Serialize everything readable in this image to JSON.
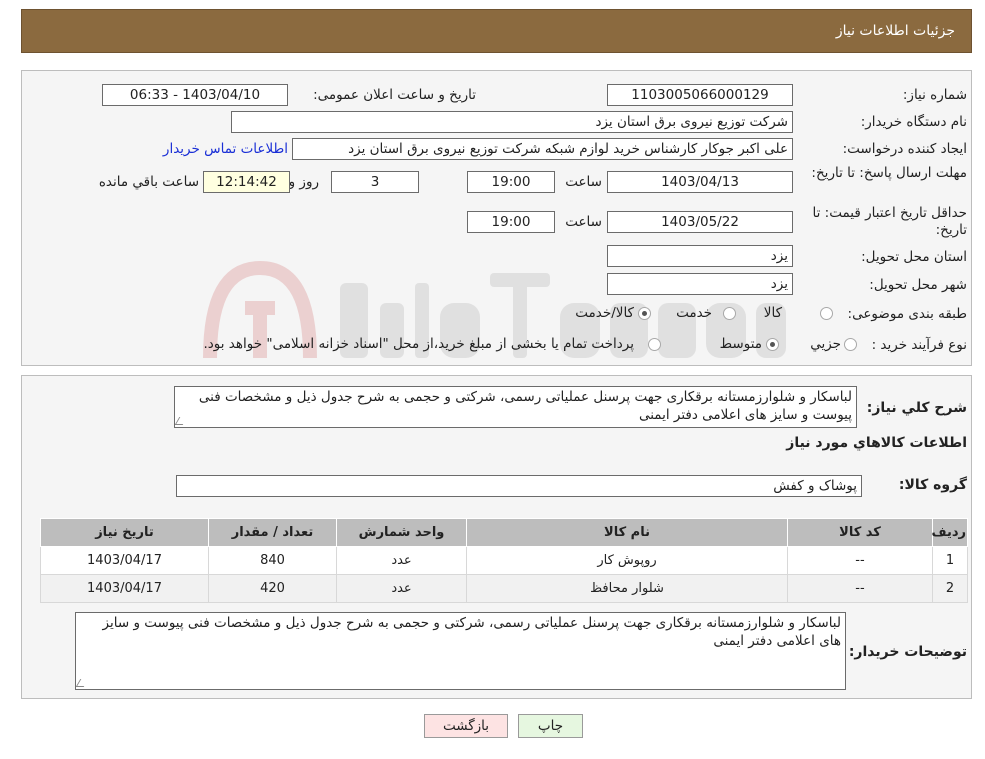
{
  "header": {
    "title": "جزئیات اطلاعات نیاز"
  },
  "form": {
    "need_number_label": "شماره نیاز:",
    "need_number": "1103005066000129",
    "announce_label": "تاریخ و ساعت اعلان عمومی:",
    "announce_value": "1403/04/10 - 06:33",
    "buyer_org_label": "نام دستگاه خریدار:",
    "buyer_org": "شرکت توزیع نیروی برق استان یزد",
    "creator_label": "ایجاد کننده درخواست:",
    "creator": "علی اکبر  جوکار  کارشناس خرید لوازم شبکه  شرکت توزیع نیروی برق استان یزد",
    "contact_link": "اطلاعات تماس خریدار",
    "reply_deadline_label": "مهلت ارسال پاسخ: تا تاریخ:",
    "reply_date": "1403/04/13",
    "time_label": "ساعت",
    "reply_time": "19:00",
    "days_value": "3",
    "days_label": "روز و",
    "remaining_time": "12:14:42",
    "remaining_label": "ساعت باقي مانده",
    "price_validity_label": "حداقل تاريخ اعتبار قیمت: تا تاریخ:",
    "validity_date": "1403/05/22",
    "validity_time": "19:00",
    "province_label": "استان محل تحویل:",
    "province": "یزد",
    "city_label": "شهر محل تحویل:",
    "city": "یزد",
    "category_label": "طبقه بندی موضوعی:",
    "category_options": [
      "کالا",
      "خدمت",
      "کالا/خدمت"
    ],
    "process_label": "نوع فرآیند خرید :",
    "process_options": [
      "جزيي",
      "متوسط"
    ],
    "process_note": "پرداخت تمام یا بخشی از مبلغ خرید،از محل \"اسناد خزانه اسلامی\" خواهد بود."
  },
  "details": {
    "summary_label": "شرح كلي نياز:",
    "summary": "لباسکار و شلوارزمستانه برقکاری  جهت پرسنل عملیاتی رسمی، شرکتی و حجمی به شرح جدول ذیل و مشخصات فنی پیوست  و سایز های اعلامی دفتر ایمنی",
    "goods_info_title": "اطلاعات كالاهاي مورد نياز",
    "group_label": "گروه کالا:",
    "group_value": "پوشاک و کفش",
    "table": {
      "headers": [
        "ردیف",
        "کد کالا",
        "نام کالا",
        "واحد شمارش",
        "تعداد / مقدار",
        "تاریخ نیاز"
      ],
      "rows": [
        [
          "1",
          "--",
          "روپوش کار",
          "عدد",
          "840",
          "1403/04/17"
        ],
        [
          "2",
          "--",
          "شلوار محافظ",
          "عدد",
          "420",
          "1403/04/17"
        ]
      ]
    },
    "buyer_notes_label": "توضیحات خریدار:",
    "buyer_notes": "لباسکار و شلوارزمستانه برقکاری  جهت پرسنل عملیاتی رسمی، شرکتی و حجمی به شرح جدول ذیل و مشخصات فنی پیوست  و سایز های اعلامی دفتر ایمنی"
  },
  "buttons": {
    "print": "چاپ",
    "back": "بازگشت"
  },
  "colors": {
    "header_bg": "#8b6a3f",
    "link": "#1a2fd6",
    "back_btn_bg": "#fde3e3",
    "print_btn_bg": "#e6f7e0"
  }
}
